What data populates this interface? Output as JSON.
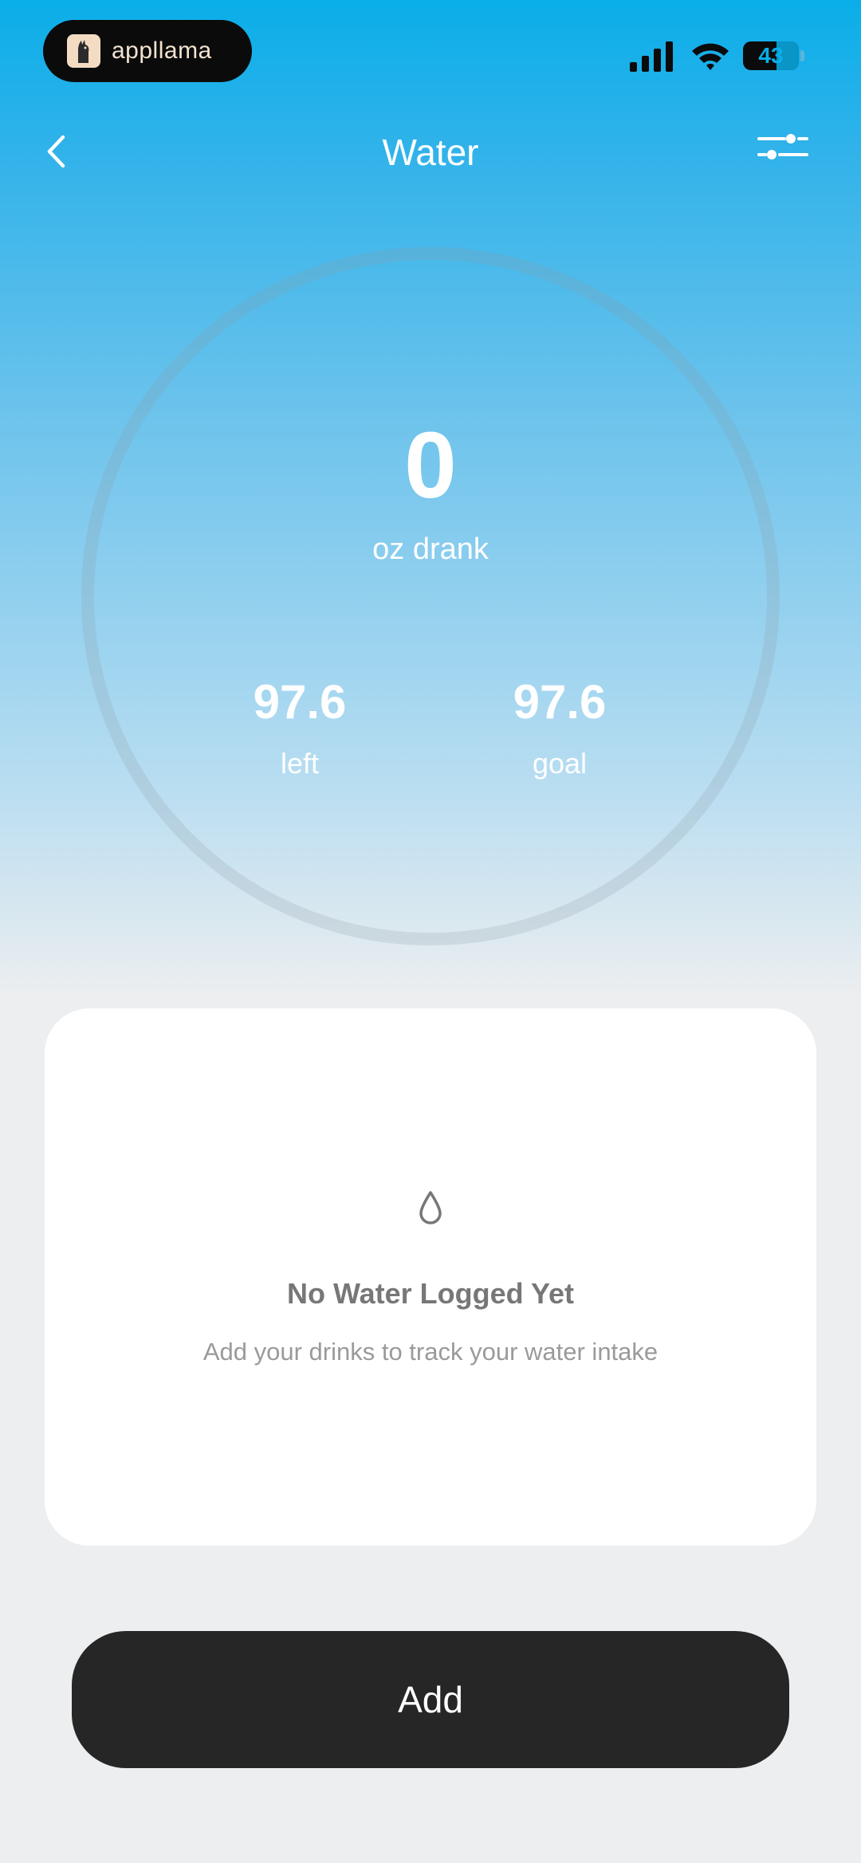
{
  "status_bar": {
    "app_pill_label": "appllama",
    "battery_level": "43",
    "icons": [
      "signal-icon",
      "wifi-icon",
      "battery-icon"
    ]
  },
  "header": {
    "title": "Water",
    "back_icon": "chevron-left-icon",
    "settings_icon": "sliders-icon"
  },
  "progress": {
    "drank_value": "0",
    "drank_label": "oz drank",
    "left_value": "97.6",
    "left_label": "left",
    "goal_value": "97.6",
    "goal_label": "goal",
    "fraction_complete": 0
  },
  "empty_state": {
    "icon": "water-drop-icon",
    "title": "No Water Logged Yet",
    "subtitle": "Add your drinks to track your water intake"
  },
  "actions": {
    "add_label": "Add"
  },
  "colors": {
    "accent_blue": "#0aaee9",
    "button_dark": "#262626",
    "background": "#eceef0"
  }
}
